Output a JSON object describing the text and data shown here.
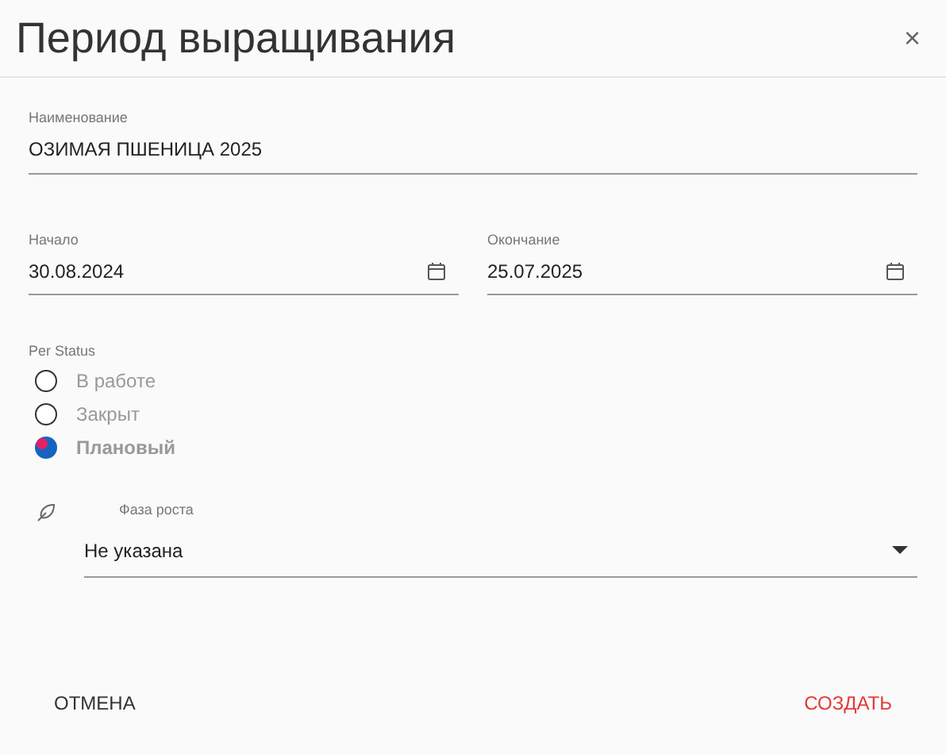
{
  "dialog": {
    "title": "Период выращивания",
    "close": "×"
  },
  "name_field": {
    "label": "Наименование",
    "value": "ОЗИМАЯ ПШЕНИЦА 2025"
  },
  "start_field": {
    "label": "Начало",
    "value": "30.08.2024"
  },
  "end_field": {
    "label": "Окончание",
    "value": "25.07.2025"
  },
  "status": {
    "label": "Per Status",
    "options": [
      {
        "label": "В работе",
        "selected": false
      },
      {
        "label": "Закрыт",
        "selected": false
      },
      {
        "label": "Плановый",
        "selected": true
      }
    ]
  },
  "phase_field": {
    "label": "Фаза роста",
    "value": "Не указана"
  },
  "buttons": [
    {
      "label": "ОТМЕНА",
      "kind": "cancel"
    },
    {
      "label": "СОЗДАТЬ",
      "kind": "primary"
    }
  ]
}
